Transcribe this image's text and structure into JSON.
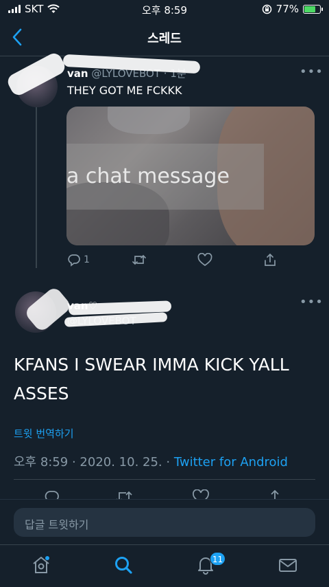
{
  "status_bar": {
    "carrier": "SKT",
    "time": "오후 8:59",
    "battery_percent": "77%",
    "battery_level": 0.77
  },
  "header": {
    "title": "스레드"
  },
  "reply_tweet": {
    "display_name": "van",
    "handle": "@LYLOVEBOT",
    "time_ago": "1분",
    "text": "THEY GOT ME FCKKK",
    "media_text": "a chat message",
    "reply_count": "1"
  },
  "main_tweet": {
    "display_name": "van♡",
    "handle": "@LYLOVEBOT",
    "text": "KFANS I SWEAR IMMA KICK YALL ASSES",
    "translate_label": "트윗 번역하기",
    "timestamp": "오후 8:59 · 2020. 10. 25. · ",
    "source": "Twitter for Android"
  },
  "composer": {
    "placeholder": "답글 트윗하기"
  },
  "tabbar": {
    "notifications_badge": "11"
  },
  "colors": {
    "background": "#15202b",
    "accent": "#1da1f2",
    "secondary_text": "#8899a6"
  }
}
